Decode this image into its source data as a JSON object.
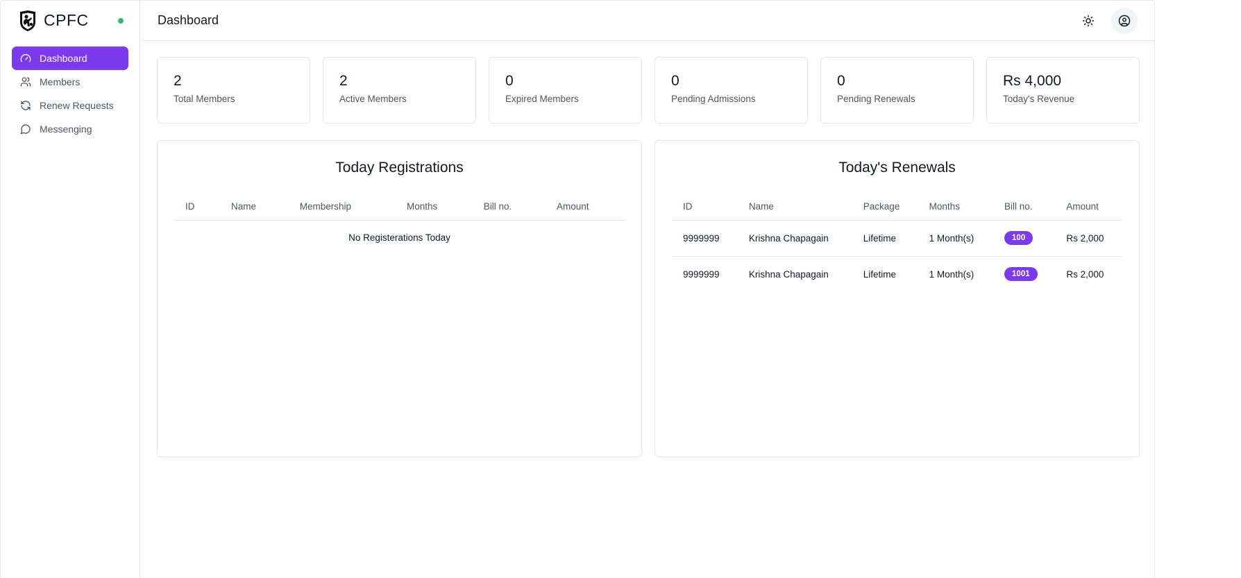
{
  "brand": {
    "name": "CPFC"
  },
  "colors": {
    "accent": "#7c3aed",
    "status": "#22c55e"
  },
  "sidebar": {
    "items": [
      {
        "label": "Dashboard",
        "icon": "gauge-icon",
        "active": true
      },
      {
        "label": "Members",
        "icon": "users-icon",
        "active": false
      },
      {
        "label": "Renew Requests",
        "icon": "refresh-icon",
        "active": false
      },
      {
        "label": "Messenging",
        "icon": "message-icon",
        "active": false
      }
    ]
  },
  "header": {
    "title": "Dashboard",
    "theme_icon": "sun-icon",
    "profile_icon": "user-circle-icon"
  },
  "stats": [
    {
      "value": "2",
      "label": "Total Members"
    },
    {
      "value": "2",
      "label": "Active Members"
    },
    {
      "value": "0",
      "label": "Expired Members"
    },
    {
      "value": "0",
      "label": "Pending Admissions"
    },
    {
      "value": "0",
      "label": "Pending Renewals"
    },
    {
      "value": "Rs 4,000",
      "label": "Today's Revenue"
    }
  ],
  "registrations": {
    "title": "Today Registrations",
    "columns": [
      "ID",
      "Name",
      "Membership",
      "Months",
      "Bill no.",
      "Amount"
    ],
    "empty_text": "No Registerations Today"
  },
  "renewals": {
    "title": "Today's Renewals",
    "columns": [
      "ID",
      "Name",
      "Package",
      "Months",
      "Bill no.",
      "Amount"
    ],
    "rows": [
      {
        "id": "9999999",
        "name": "Krishna Chapagain",
        "package": "Lifetime",
        "months": "1 Month(s)",
        "bill": "100",
        "amount": "Rs 2,000"
      },
      {
        "id": "9999999",
        "name": "Krishna Chapagain",
        "package": "Lifetime",
        "months": "1 Month(s)",
        "bill": "1001",
        "amount": "Rs 2,000"
      }
    ]
  }
}
